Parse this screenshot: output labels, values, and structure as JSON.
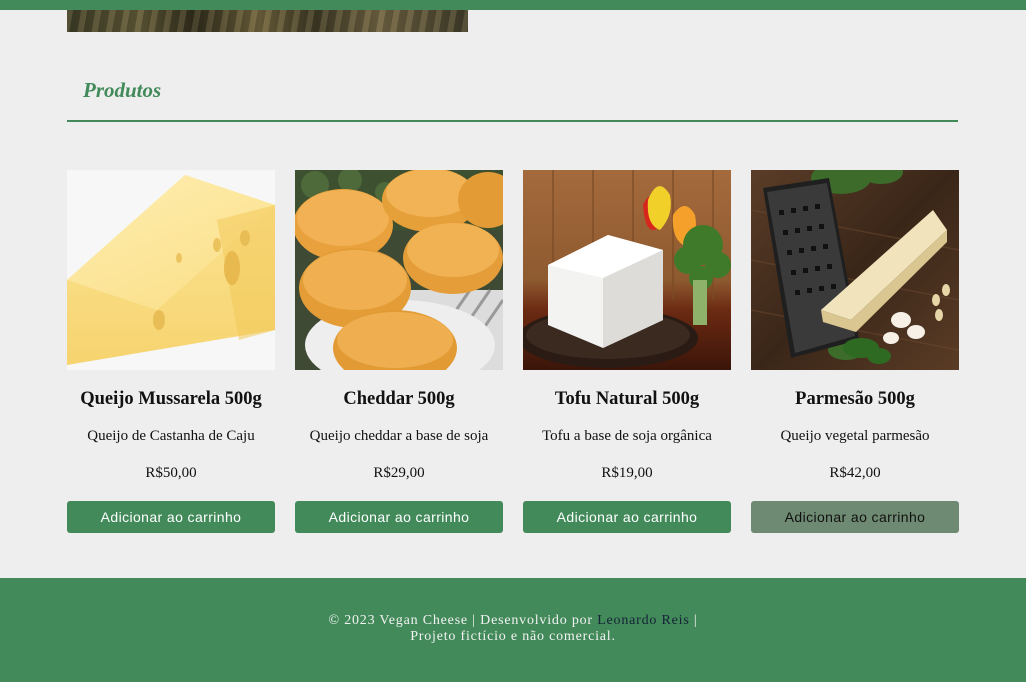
{
  "section": {
    "title": "Produtos"
  },
  "products": [
    {
      "name": "Queijo Mussarela 500g",
      "description": "Queijo de Castanha de Caju",
      "price": "R$50,00",
      "button": "Adicionar ao carrinho",
      "image": "mozzarella-wedge"
    },
    {
      "name": "Cheddar 500g",
      "description": "Queijo cheddar a base de soja",
      "price": "R$29,00",
      "button": "Adicionar ao carrinho",
      "image": "cheddar-wheels"
    },
    {
      "name": "Tofu Natural 500g",
      "description": "Tofu a base de soja orgânica",
      "price": "R$19,00",
      "button": "Adicionar ao carrinho",
      "image": "tofu-block"
    },
    {
      "name": "Parmesão 500g",
      "description": "Queijo vegetal parmesão",
      "price": "R$42,00",
      "button": "Adicionar ao carrinho",
      "image": "parmesan-grater"
    }
  ],
  "footer": {
    "copyright": "© 2023 Vegan Cheese | Desenvolvido por ",
    "author_link": "Leonardo Reis",
    "separator": " |",
    "note": "Projeto fictício e não comercial."
  },
  "colors": {
    "brand_green": "#428a5a",
    "button_hover": "#6e8a72",
    "background": "#eeeeee",
    "link": "#152238"
  }
}
